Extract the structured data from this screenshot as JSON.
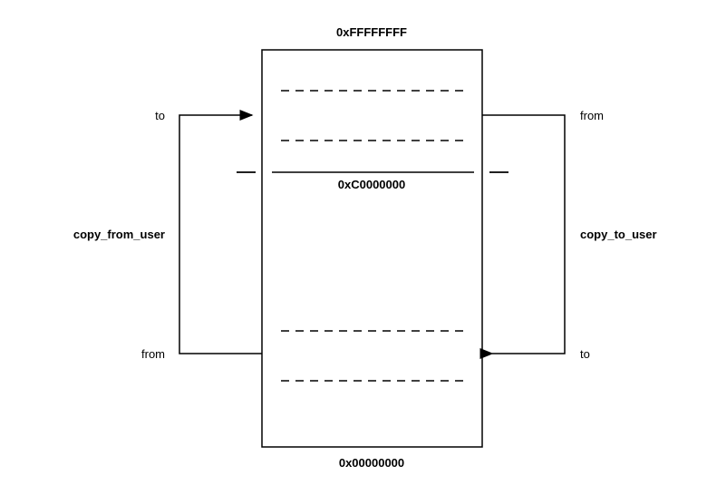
{
  "memory": {
    "top_address": "0xFFFFFFFF",
    "boundary_address": "0xC0000000",
    "bottom_address": "0x00000000"
  },
  "left_op": {
    "name": "copy_from_user",
    "top_label": "to",
    "bottom_label": "from"
  },
  "right_op": {
    "name": "copy_to_user",
    "top_label": "from",
    "bottom_label": "to"
  }
}
